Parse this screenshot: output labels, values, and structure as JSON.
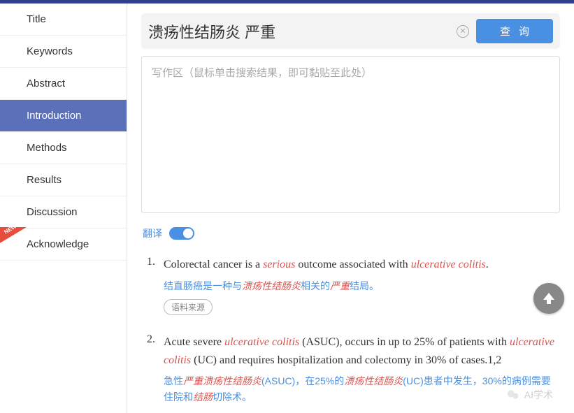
{
  "sidebar": {
    "items": [
      {
        "label": "Title"
      },
      {
        "label": "Keywords"
      },
      {
        "label": "Abstract"
      },
      {
        "label": "Introduction"
      },
      {
        "label": "Methods"
      },
      {
        "label": "Results"
      },
      {
        "label": "Discussion"
      },
      {
        "label": "Acknowledge"
      }
    ],
    "active_index": 3,
    "new_label": "NEW"
  },
  "search": {
    "value": "溃疡性结肠炎 严重",
    "query_label": "查询"
  },
  "writearea": {
    "placeholder": "写作区（鼠标单击搜索结果，即可黏贴至此处）"
  },
  "translate": {
    "label": "翻译",
    "on": true
  },
  "results": [
    {
      "num": "1.",
      "en_parts": [
        {
          "t": "Colorectal cancer is a ",
          "hl": false
        },
        {
          "t": "serious",
          "hl": true
        },
        {
          "t": " outcome associated with ",
          "hl": false
        },
        {
          "t": "ulcerative colitis",
          "hl": true
        },
        {
          "t": ".",
          "hl": false
        }
      ],
      "zh_parts": [
        {
          "t": "结直肠癌是一种与",
          "hl": false
        },
        {
          "t": "溃疡性结肠炎",
          "hl": true
        },
        {
          "t": "相关的",
          "hl": false
        },
        {
          "t": "严重",
          "hl": true
        },
        {
          "t": "结局。",
          "hl": false
        }
      ],
      "source_label": "语料来源"
    },
    {
      "num": "2.",
      "en_parts": [
        {
          "t": "Acute severe ",
          "hl": false
        },
        {
          "t": "ulcerative colitis",
          "hl": true
        },
        {
          "t": " (ASUC), occurs in up to 25% of patients with ",
          "hl": false
        },
        {
          "t": "ulcerative colitis",
          "hl": true
        },
        {
          "t": " (UC) and requires hospitalization and colectomy in 30% of cases.1,2",
          "hl": false
        }
      ],
      "zh_parts": [
        {
          "t": "急性",
          "hl": false
        },
        {
          "t": "严重溃疡性结肠炎",
          "hl": true
        },
        {
          "t": "(ASUC)，在25%的",
          "hl": false
        },
        {
          "t": "溃疡性结肠炎",
          "hl": true
        },
        {
          "t": "(UC)患者中发生，30%的病例需要住院和",
          "hl": false
        },
        {
          "t": "结肠",
          "hl": true
        },
        {
          "t": "切除术。",
          "hl": false
        }
      ]
    }
  ],
  "watermark": {
    "text": "AI学术"
  }
}
